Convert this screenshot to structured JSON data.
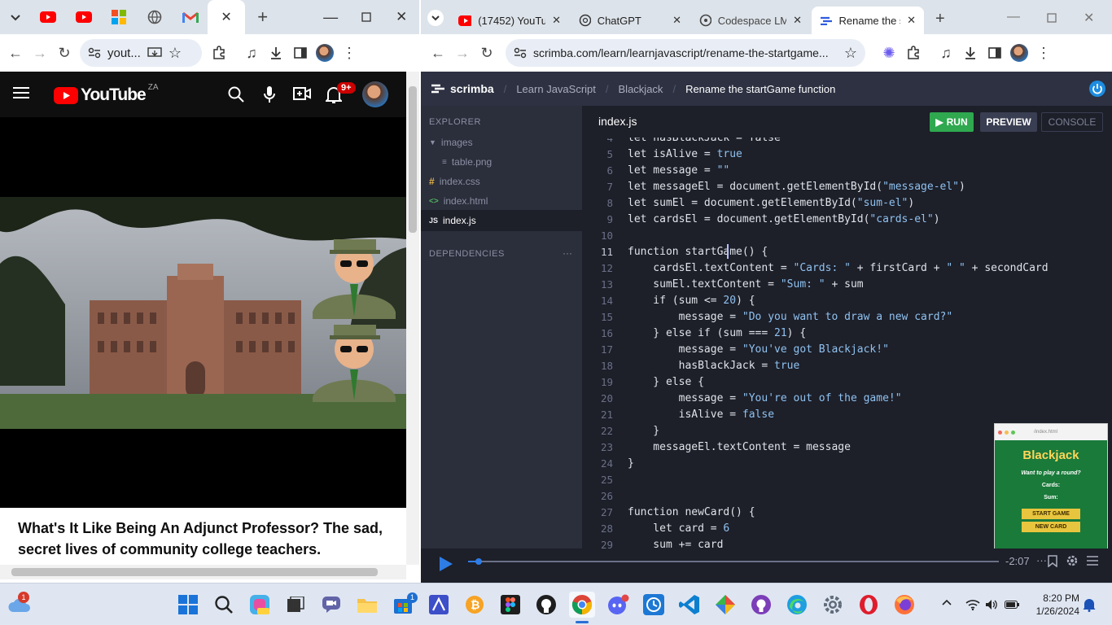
{
  "left_browser": {
    "address": "yout...",
    "youtube": {
      "logo_text": "YouTube",
      "region": "ZA",
      "notif_badge": "9+",
      "video_title": "What's It Like Being An Adjunct Professor? The sad, secret lives of community college teachers."
    }
  },
  "right_browser": {
    "tabs": [
      {
        "label": "(17452) YouTu"
      },
      {
        "label": "ChatGPT"
      },
      {
        "label": "Codespace LM"
      },
      {
        "label": "Rename the st"
      }
    ],
    "address": "scrimba.com/learn/learnjavascript/rename-the-startgame...",
    "scrimba": {
      "brand": "scrimba",
      "breadcrumb": [
        "Learn JavaScript",
        "Blackjack",
        "Rename the startGame function"
      ],
      "sidebar": {
        "explorer_label": "EXPLORER",
        "folder": "images",
        "files": [
          "table.png",
          "index.css",
          "index.html",
          "index.js"
        ],
        "dependencies_label": "DEPENDENCIES",
        "dependencies_more": "···"
      },
      "editor": {
        "filename": "index.js",
        "run_label": "RUN",
        "preview_label": "PREVIEW",
        "console_label": "CONSOLE",
        "line_numbers": [
          "4",
          "5",
          "6",
          "7",
          "8",
          "9",
          "10",
          "11",
          "12",
          "13",
          "14",
          "15",
          "16",
          "17",
          "18",
          "19",
          "20",
          "21",
          "22",
          "23",
          "24",
          "25",
          "26",
          "27",
          "28",
          "29"
        ]
      },
      "preview": {
        "url": "/index.html",
        "title": "Blackjack",
        "question": "Want to play a round?",
        "cards_label": "Cards:",
        "sum_label": "Sum:",
        "start_button": "START GAME",
        "new_card_button": "NEW CARD"
      },
      "player": {
        "time": "-2:07",
        "more": "···",
        "progress": 0.02
      }
    }
  },
  "taskbar": {
    "weather_badge": "1",
    "store_badge": "1",
    "time": "8:20 PM",
    "date": "1/26/2024"
  }
}
